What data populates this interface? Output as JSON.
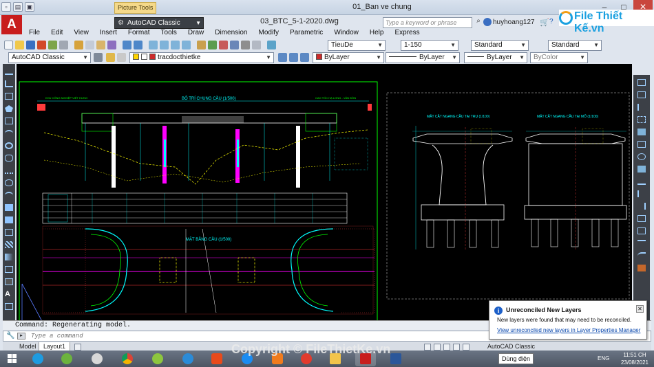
{
  "window": {
    "title": "01_Ban ve chung",
    "picture_tools_label": "Picture Tools"
  },
  "acad": {
    "logo_letter": "A",
    "workspace": "AutoCAD Classic",
    "file_title": "03_BTC_5-1-2020.dwg",
    "search_placeholder": "Type a keyword or phrase",
    "user_name": "huyhoang127"
  },
  "watermark": {
    "text": "File Thiết Kế.vn"
  },
  "menu": [
    "File",
    "Edit",
    "View",
    "Insert",
    "Format",
    "Tools",
    "Draw",
    "Dimension",
    "Modify",
    "Parametric",
    "Window",
    "Help",
    "Express"
  ],
  "toolbar1": {
    "text_style": "TieuDe",
    "dim_scale": "1-150",
    "dim_style": "Standard",
    "table_style": "Standard"
  },
  "toolbar2": {
    "workspace": "AutoCAD Classic",
    "layer": "tracdocthietke",
    "color": "ByLayer",
    "linetype": "ByLayer",
    "lineweight": "ByLayer",
    "plotstyle": "ByColor"
  },
  "drawing": {
    "plan_title": "BỐ TRÍ CHUNG CẦU (1/500)",
    "plan_view_title": "MẶT BẰNG CẦU (1/500)",
    "section1_title": "MẶT CẮT NGANG CẦU TẠI TRỤ (1/100)",
    "section2_title": "MẶT CẮT NGANG CẦU TẠI MỐ (1/100)",
    "left_caption": "KHU CÔNG NGHIỆP VIỆT HƯNG",
    "right_caption": "CAO TỐC HẠ LONG - VÂN ĐỒN"
  },
  "command": {
    "history": "Command: Regenerating model.",
    "placeholder": "Type a command"
  },
  "layout_tabs": [
    "Model",
    "Layout1"
  ],
  "status": {
    "workspace": "AutoCAD Classic"
  },
  "balloon": {
    "title": "Unreconciled New Layers",
    "message": "New layers were found that may need to be reconciled.",
    "link": "View unreconciled new layers in Layer Properties Manager"
  },
  "taskbar": {
    "tray_label": "Dùng điện",
    "lang": "ENG",
    "time": "11:51 CH",
    "date": "23/08/2021"
  },
  "overlay": {
    "copyright": "Copyright © FileThietKe.vn"
  },
  "colors": {
    "canvas": "#000000",
    "cyan": "#00ffff",
    "yellow": "#ffff00",
    "magenta": "#ff00ff",
    "red": "#ff3b3b",
    "green": "#00ff00"
  }
}
